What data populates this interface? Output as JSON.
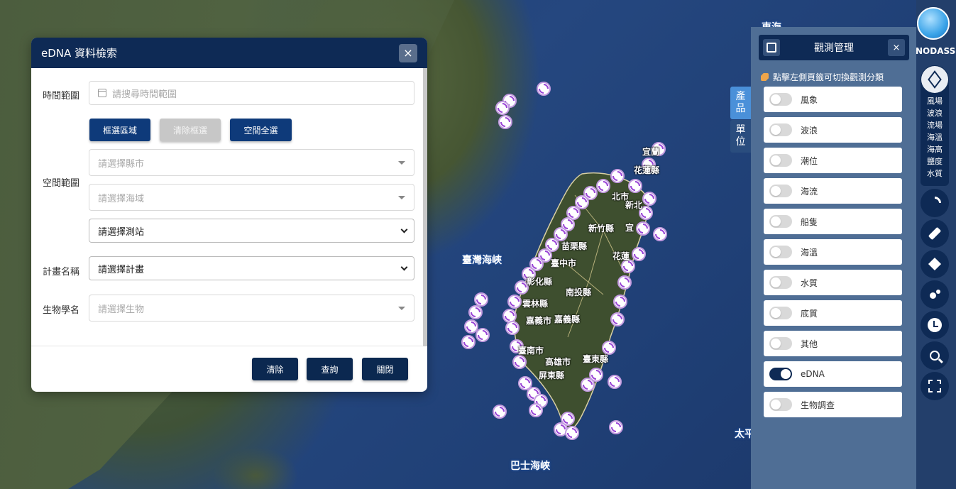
{
  "map": {
    "labels": {
      "strait_taiwan": "臺灣海峽",
      "strait_bashi": "巴士海峽",
      "east_sea": "東海",
      "pacific": "太平"
    },
    "counties": [
      "新竹縣",
      "苗栗縣",
      "臺中市",
      "彰化縣",
      "南投縣",
      "雲林縣",
      "嘉義市",
      "嘉義縣",
      "臺南市",
      "高雄市",
      "屏東縣",
      "臺東縣",
      "花蓮",
      "宜",
      "北市",
      "新北",
      "宜蘭",
      "花蓮縣"
    ]
  },
  "edna_modal": {
    "title": "eDNA 資料檢索",
    "close": "×",
    "time_range_label": "時間範圍",
    "time_range_placeholder": "請搜尋時間範圍",
    "space_range_label": "空間範圍",
    "btn_box_select": "框選區域",
    "btn_clear_box": "清除框選",
    "btn_select_all_space": "空間全選",
    "county_placeholder": "請選擇縣市",
    "sea_placeholder": "請選擇海域",
    "station_select": "請選擇測站",
    "project_label": "計畫名稱",
    "project_select": "請選擇計畫",
    "species_label": "生物學名",
    "species_placeholder": "請選擇生物",
    "btn_clear": "清除",
    "btn_query": "查詢",
    "btn_close": "關閉"
  },
  "obs_panel": {
    "title": "觀測管理",
    "close": "×",
    "hint": "點擊左側頁籤可切換觀測分類",
    "items": [
      {
        "label": "風象",
        "on": false
      },
      {
        "label": "波浪",
        "on": false
      },
      {
        "label": "潮位",
        "on": false
      },
      {
        "label": "海流",
        "on": false
      },
      {
        "label": "船隻",
        "on": false
      },
      {
        "label": "海溫",
        "on": false
      },
      {
        "label": "水質",
        "on": false
      },
      {
        "label": "底質",
        "on": false
      },
      {
        "label": "其他",
        "on": false
      },
      {
        "label": "eDNA",
        "on": true
      },
      {
        "label": "生物調查",
        "on": false
      }
    ],
    "tab_product": "產品",
    "tab_unit": "單位"
  },
  "toolbar": {
    "logo_text": "NODASS",
    "products": [
      "風場",
      "波浪",
      "流場",
      "海溫",
      "海高",
      "鹽度",
      "水質"
    ],
    "icons": [
      "cube-icon",
      "broadcast-icon",
      "satellite-icon",
      "layers-icon",
      "dots-icon",
      "clock-icon",
      "search-icon",
      "expand-icon"
    ]
  },
  "colors": {
    "navy": "#0e2a55",
    "panel": "#4f6e95",
    "tab_active": "#4a90d9",
    "station_purple": "#9a45d6"
  }
}
